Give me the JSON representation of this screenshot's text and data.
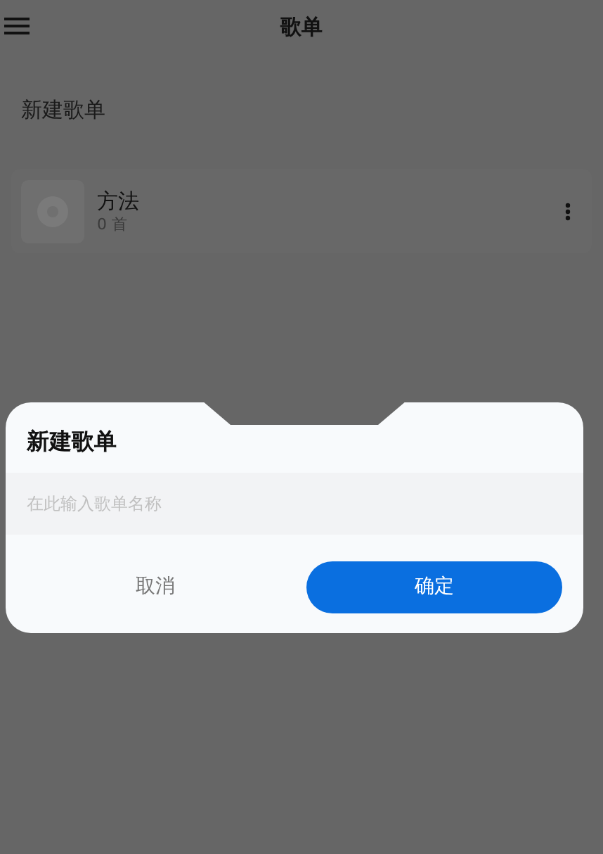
{
  "header": {
    "title": "歌单"
  },
  "new_playlist": {
    "label": "新建歌单"
  },
  "playlists": [
    {
      "name": "方法",
      "count": "0 首"
    }
  ],
  "dialog": {
    "title": "新建歌单",
    "input": {
      "placeholder": "在此输入歌单名称"
    },
    "buttons": [
      {
        "label": "取消",
        "kind": "secondary"
      },
      {
        "label": "确定",
        "kind": "primary"
      }
    ]
  }
}
